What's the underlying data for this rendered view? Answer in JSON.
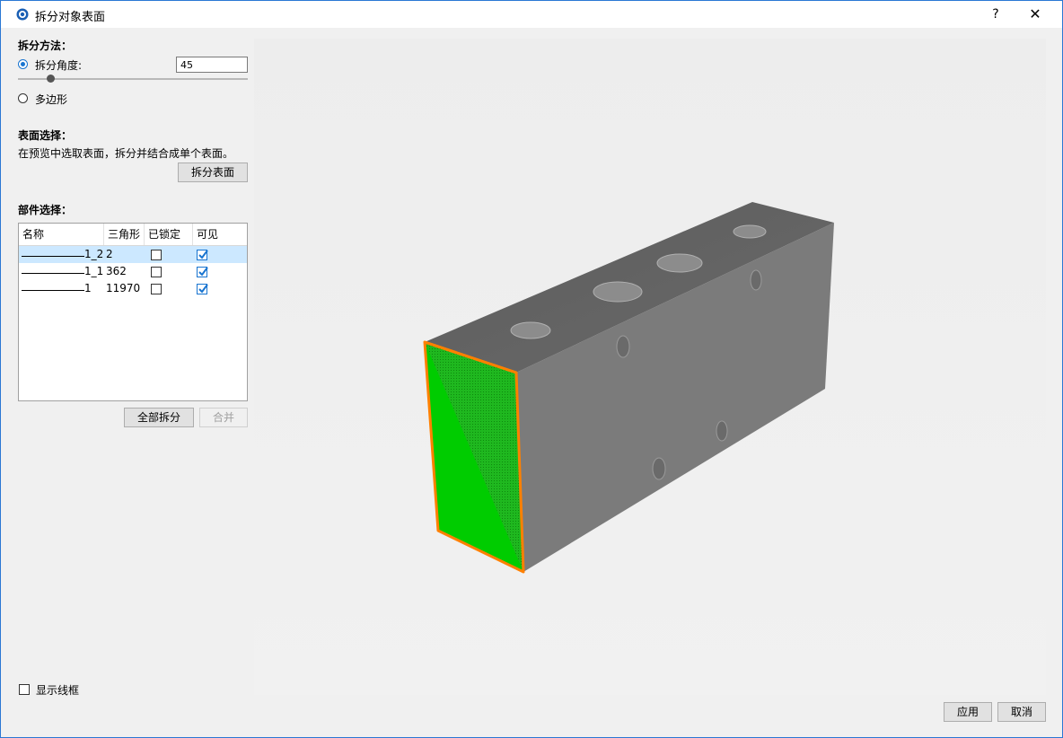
{
  "window": {
    "title": "拆分对象表面",
    "help_label": "?",
    "close_label": "✕"
  },
  "split_method": {
    "title": "拆分方法：",
    "angle_label": "拆分角度:",
    "angle_value": "45",
    "polygon_label": "多边形",
    "selected": "angle"
  },
  "surface_selection": {
    "title": "表面选择：",
    "hint": "在预览中选取表面，拆分并结合成单个表面。",
    "split_button": "拆分表面"
  },
  "part_selection": {
    "title": "部件选择：",
    "columns": [
      "名称",
      "三角形",
      "已锁定",
      "可见"
    ],
    "rows": [
      {
        "name": "1_2",
        "triangles": "2",
        "locked": false,
        "visible": true
      },
      {
        "name": "1_1",
        "triangles": "362",
        "locked": false,
        "visible": true
      },
      {
        "name": "1",
        "triangles": "11970",
        "locked": false,
        "visible": true
      }
    ],
    "split_all_button": "全部拆分",
    "merge_button": "合并"
  },
  "show_wireframe_label": "显示线框",
  "apply_button": "应用",
  "cancel_button": "取消",
  "colors": {
    "accent": "#1874d0",
    "selected_row": "#cce8ff",
    "face_highlight": "#00cc00",
    "edge_highlight": "#ff8000",
    "model_gray": "#7a7a7a"
  }
}
